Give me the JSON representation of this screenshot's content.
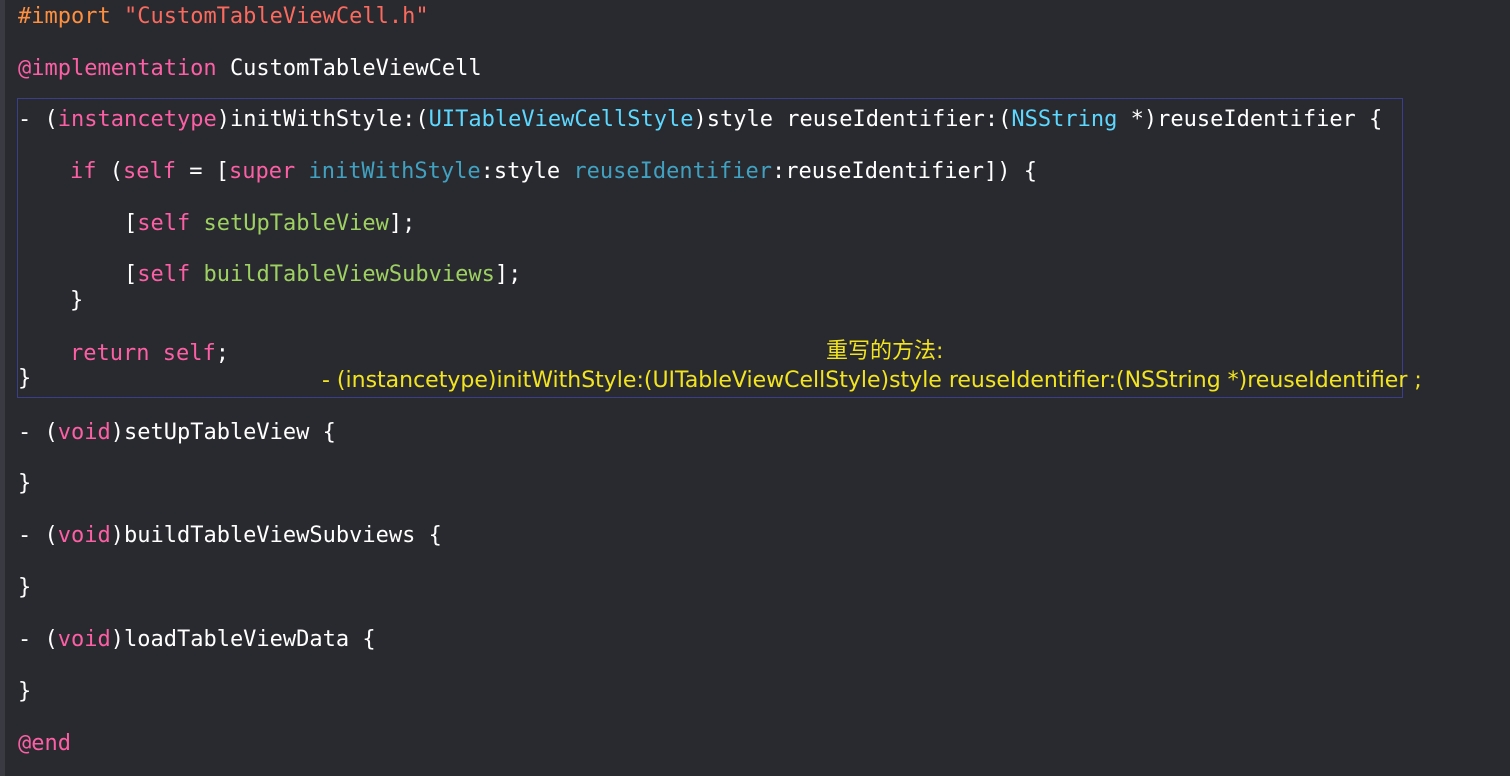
{
  "colors": {
    "background": "#292a30",
    "keyword": "#fc5fa3",
    "preprocessor": "#fd8f3f",
    "string": "#fc6a5d",
    "type": "#5dd8ff",
    "method": "#67b7a4",
    "annotation": "#f2e41e",
    "selection_border": "#3b3f8a"
  },
  "code": {
    "import_kw": "#import",
    "import_str": "\"CustomTableViewCell.h\"",
    "impl_kw": "@implementation",
    "impl_name": "CustomTableViewCell",
    "l3_a": "- (",
    "l3_kw": "instancetype",
    "l3_b": ")initWithStyle:(",
    "l3_type1": "UITableViewCellStyle",
    "l3_c": ")style reuseIdentifier:(",
    "l3_type2": "NSString",
    "l3_d": " *)reuseIdentifier {",
    "l4_if": "if",
    "l4_a": " (",
    "l4_self": "self",
    "l4_b": " = [",
    "l4_super": "super",
    "l4_c": " ",
    "l4_m1": "initWithStyle",
    "l4_d": ":style ",
    "l4_m2": "reuseIdentifier",
    "l4_e": ":reuseIdentifier]) {",
    "l5_a": "[",
    "l5_self": "self",
    "l5_b": " ",
    "l5_m": "setUpTableView",
    "l5_c": "];",
    "l6_a": "[",
    "l6_self": "self",
    "l6_b": " ",
    "l6_m": "buildTableViewSubviews",
    "l6_c": "];",
    "l7": "}",
    "l8_ret": "return",
    "l8_a": " ",
    "l8_self": "self",
    "l8_b": ";",
    "l9": "}",
    "l10_a": "- (",
    "l10_kw": "void",
    "l10_b": ")setUpTableView {",
    "l11": "}",
    "l12_a": "- (",
    "l12_kw": "void",
    "l12_b": ")buildTableViewSubviews {",
    "l13": "}",
    "l14_a": "- (",
    "l14_kw": "void",
    "l14_b": ")loadTableViewData {",
    "l15": "}",
    "end_kw": "@end"
  },
  "annotation": {
    "title": "重写的方法:",
    "signature": "- (instancetype)initWithStyle:(UITableViewCellStyle)style reuseIdentifier:(NSString *)reuseIdentifier ;"
  }
}
